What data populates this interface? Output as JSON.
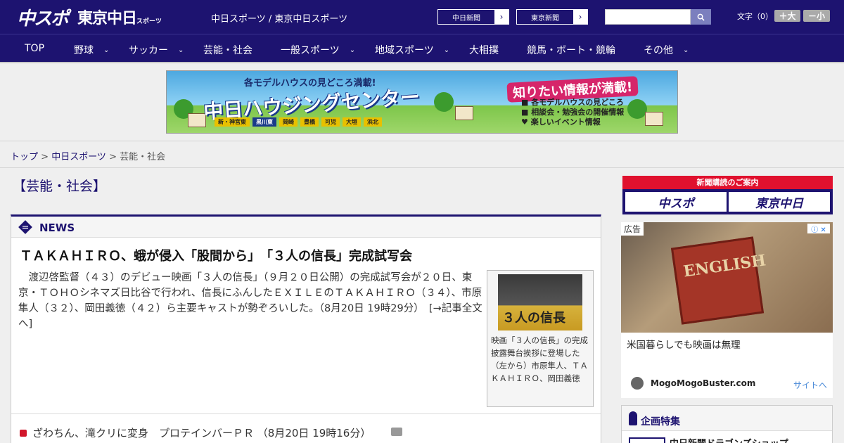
{
  "header": {
    "logo_chuspo": "中スポ",
    "logo_tokyo": "東京中日",
    "logo_tokyo_small": "スポーツ",
    "site_names": "中日スポーツ / 東京中日スポーツ",
    "btn_chunichi": "中日新聞",
    "btn_tokyo": "東京新聞",
    "arrow": "›",
    "search_placeholder": "",
    "font_label": "文字（0）",
    "font_large": "＋大",
    "font_small": "－小"
  },
  "nav": {
    "items": [
      "TOP",
      "野球",
      "サッカー",
      "芸能・社会",
      "一般スポーツ",
      "地域スポーツ",
      "大相撲",
      "競馬・ボート・競輪",
      "その他"
    ],
    "chevron": "⌄"
  },
  "banner": {
    "top_text": "各モデルハウスの見どころ満載!",
    "main_text": "中日ハウジングセンター",
    "towns": [
      "新・神宮東",
      "黒川東",
      "岡崎",
      "豊橋",
      "可児",
      "大垣",
      "浜北"
    ],
    "right_title": "知りたい情報が満載!",
    "right_list": [
      "■ 各モデルハウスの見どころ",
      "■ 相談会・勉強会の開催情報",
      "♥ 楽しいイベント情報"
    ]
  },
  "breadcrumb": {
    "home": "トップ",
    "sep": " > ",
    "parent": "中日スポーツ",
    "current": "芸能・社会"
  },
  "section": {
    "title": "【芸能・社会】"
  },
  "news": {
    "label": "NEWS",
    "headline": "ＴＡＫＡＨＩＲＯ、蛾が侵入「股間から」　「３人の信長」完成試写会",
    "body": "　渡辺啓監督（４３）のデビュー映画「３人の信長」（９月２０日公開）の完成試写会が２０日、東京・ＴＯＨＯシネマズ日比谷で行われ、信長にふんしたＥＸＩＬＥのＴＡＫＡＨＩＲＯ（３４）、市原隼人（３２）、岡田義徳（４２）ら主要キャストが勢ぞろいした。（8月20日 19時29分）　[→記事全文へ]",
    "photo_title": "３人の信長",
    "photo_caption": "映画「３人の信長」の完成披露舞台挨拶に登場した（左から）市原隼人、ＴＡＫＡＨＩＲＯ、岡田義徳",
    "sub_item": "ざわちん、滝クリに変身　プロテインバーＰＲ （8月20日 19時16分）"
  },
  "sidebar": {
    "subscribe_header": "新聞購読のご案内",
    "subscribe_chuspo": "中スポ",
    "subscribe_tokyo": "東京中日",
    "ad_tag": "広告",
    "ad_choices": "ⓘ ✕",
    "ad_book_text": "ENGLISH",
    "ad_title": "米国暮らしでも映画は無理",
    "ad_source": "MogoMogoBuster.com",
    "ad_link": "サイトへ",
    "feature_label": "企画特集",
    "feature_item": "中日新聞ドラゴンズショップ"
  },
  "colors": {
    "brand_navy": "#1d1370",
    "brand_red": "#e0112e",
    "link": "#1d1370"
  }
}
